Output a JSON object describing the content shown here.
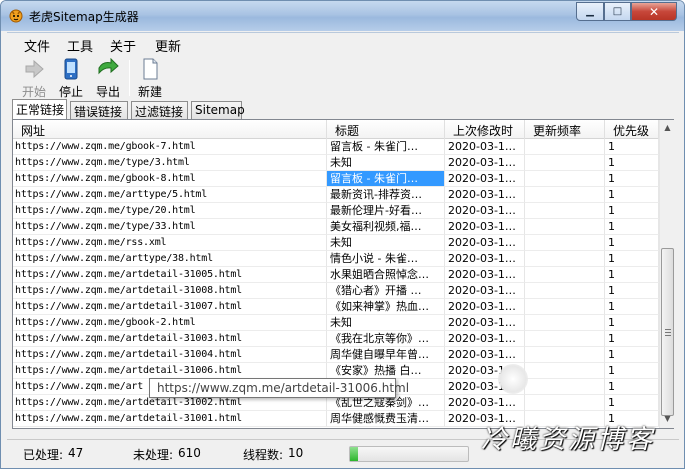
{
  "window": {
    "title": "老虎Sitemap生成器",
    "min_glyph": "▁",
    "max_glyph": "□",
    "close_glyph": "✕"
  },
  "menu": [
    "文件",
    "工具",
    "关于",
    "更新"
  ],
  "toolbar": {
    "start_label": "开始",
    "start_icon": "play-arrow-icon",
    "start_enabled": false,
    "stop_label": "停止",
    "stop_icon": "phone-stop-icon",
    "export_label": "导出",
    "export_icon": "export-arrow-icon",
    "new_label": "新建",
    "new_icon": "new-document-icon"
  },
  "tabs": [
    "正常链接",
    "错误链接",
    "过滤链接",
    "Sitemap"
  ],
  "active_tab": 0,
  "columns": [
    "网址",
    "标题",
    "上次修改时",
    "更新频率",
    "优先级"
  ],
  "rows": [
    {
      "url": "https://www.zqm.me/gbook-7.html",
      "title": "留言板 - 朱雀门…",
      "date": "2020-03-1…",
      "freq": "",
      "priority": "1"
    },
    {
      "url": "https://www.zqm.me/type/3.html",
      "title": "未知",
      "date": "2020-03-1…",
      "freq": "",
      "priority": "1"
    },
    {
      "url": "https://www.zqm.me/gbook-8.html",
      "title": "留言板 - 朱雀门…",
      "date": "2020-03-1…",
      "freq": "",
      "priority": "1",
      "selected": true
    },
    {
      "url": "https://www.zqm.me/arttype/5.html",
      "title": "最新资讯-排荐资…",
      "date": "2020-03-1…",
      "freq": "",
      "priority": "1"
    },
    {
      "url": "https://www.zqm.me/type/20.html",
      "title": "最新伦理片-好看…",
      "date": "2020-03-1…",
      "freq": "",
      "priority": "1"
    },
    {
      "url": "https://www.zqm.me/type/33.html",
      "title": "美女福利视频,福…",
      "date": "2020-03-1…",
      "freq": "",
      "priority": "1"
    },
    {
      "url": "https://www.zqm.me/rss.xml",
      "title": "未知",
      "date": "2020-03-1…",
      "freq": "",
      "priority": "1"
    },
    {
      "url": "https://www.zqm.me/arttype/38.html",
      "title": "情色小说 - 朱雀…",
      "date": "2020-03-1…",
      "freq": "",
      "priority": "1"
    },
    {
      "url": "https://www.zqm.me/artdetail-31005.html",
      "title": "水果姐晒合照悼念…",
      "date": "2020-03-1…",
      "freq": "",
      "priority": "1"
    },
    {
      "url": "https://www.zqm.me/artdetail-31008.html",
      "title": "《猎心者》开播 …",
      "date": "2020-03-1…",
      "freq": "",
      "priority": "1"
    },
    {
      "url": "https://www.zqm.me/artdetail-31007.html",
      "title": "《如来神掌》热血…",
      "date": "2020-03-1…",
      "freq": "",
      "priority": "1"
    },
    {
      "url": "https://www.zqm.me/gbook-2.html",
      "title": "未知",
      "date": "2020-03-1…",
      "freq": "",
      "priority": "1"
    },
    {
      "url": "https://www.zqm.me/artdetail-31003.html",
      "title": "《我在北京等你》…",
      "date": "2020-03-1…",
      "freq": "",
      "priority": "1"
    },
    {
      "url": "https://www.zqm.me/artdetail-31004.html",
      "title": "周华健自曝早年曾…",
      "date": "2020-03-1…",
      "freq": "",
      "priority": "1"
    },
    {
      "url": "https://www.zqm.me/artdetail-31006.html",
      "title": "《安家》热播 白…",
      "date": "2020-03-1…",
      "freq": "",
      "priority": "1"
    },
    {
      "url": "https://www.zqm.me/art",
      "title": "黄子…",
      "date": "2020-03-1…",
      "freq": "",
      "priority": "1"
    },
    {
      "url": "https://www.zqm.me/artdetail-31002.html",
      "title": "《乱世之寇秦剑》…",
      "date": "2020-03-1…",
      "freq": "",
      "priority": "1"
    },
    {
      "url": "https://www.zqm.me/artdetail-31001.html",
      "title": "周华健感慨费玉清…",
      "date": "2020-03-1…",
      "freq": "",
      "priority": "1"
    }
  ],
  "tooltip": "https://www.zqm.me/artdetail-31006.html",
  "status": {
    "processed_label": "已处理:",
    "processed": "47",
    "pending_label": "未处理:",
    "pending": "610",
    "threads_label": "线程数:",
    "threads": "10",
    "progress": 0.07
  },
  "watermark": "冷曦资源博客"
}
